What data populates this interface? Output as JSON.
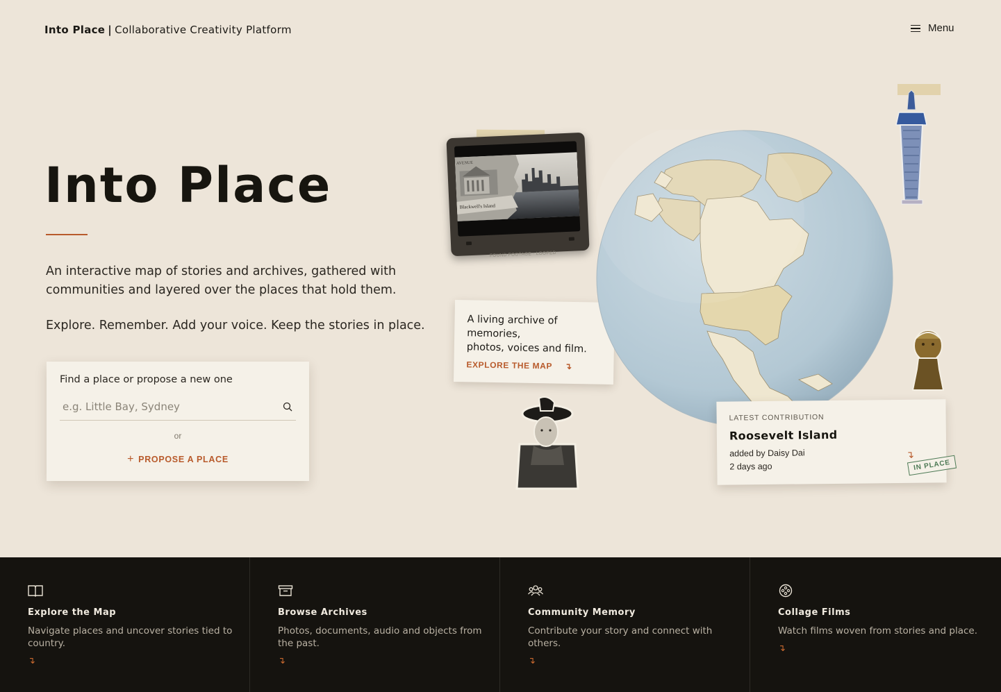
{
  "header": {
    "brand_name": "Into Place",
    "brand_separator": "|",
    "brand_tagline": "Collaborative Creativity Platform",
    "menu_label": "Menu"
  },
  "hero": {
    "title": "Into Place",
    "description": "An interactive map of stories and archives, gathered with communities and layered over the places that hold them.",
    "tagline": "Explore. Remember. Add your voice. Keep the stories in place."
  },
  "search": {
    "label": "Find a place or propose a new one",
    "placeholder": "e.g. Little Bay, Sydney",
    "or_label": "or",
    "propose_icon": "+",
    "propose_label": "PROPOSE A PLACE"
  },
  "video_card": {
    "screen_text_left": "Blackwell's Island",
    "screen_text_top": "AVENUE",
    "caption": "FOUND FOOTAGE · LOOPED"
  },
  "note_card": {
    "text_line1": "A living archive of memories,",
    "text_line2": "photos, voices and film.",
    "link_label": "EXPLORE THE MAP",
    "link_arrow": "↴"
  },
  "latest": {
    "kicker": "LATEST CONTRIBUTION",
    "title": "Roosevelt Island",
    "added_by": "added by Daisy Dai",
    "time_ago": "2 days ago",
    "arrow": "↴",
    "stamp": "IN PLACE"
  },
  "features": [
    {
      "icon": "book-icon",
      "title": "Explore the Map",
      "description": "Navigate places and uncover stories tied to country.",
      "arrow": "↴"
    },
    {
      "icon": "archive-box-icon",
      "title": "Browse Archives",
      "description": "Photos, documents, audio and objects from the past.",
      "arrow": "↴"
    },
    {
      "icon": "people-icon",
      "title": "Community Memory",
      "description": "Contribute your story and connect with others.",
      "arrow": "↴"
    },
    {
      "icon": "film-reel-icon",
      "title": "Collage Films",
      "description": "Watch films woven from stories and place.",
      "arrow": "↴"
    }
  ],
  "colors": {
    "background": "#ede5d9",
    "accent": "#b85a2b",
    "card": "#f5f1e8",
    "footer": "#15130f",
    "stamp_green": "#4d7a55"
  }
}
